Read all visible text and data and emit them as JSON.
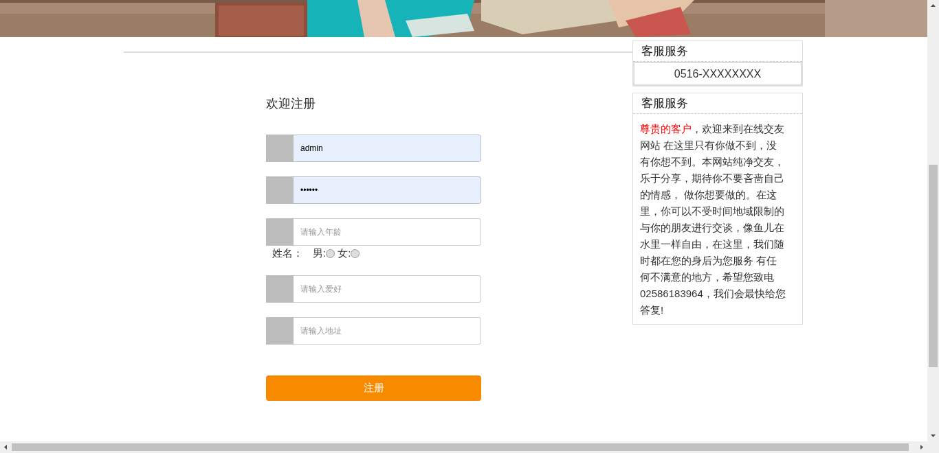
{
  "form": {
    "title": "欢迎注册",
    "fields": [
      {
        "kind": "input",
        "value": "admin",
        "autofilled": true
      },
      {
        "kind": "input",
        "value": "••••••",
        "autofilled": true
      },
      {
        "kind": "input",
        "placeholder": "请输入年龄",
        "autofilled": false
      },
      {
        "kind": "gender",
        "label": "姓名：",
        "options": [
          {
            "label": "男:",
            "selected": false
          },
          {
            "label": "女:",
            "selected": false
          }
        ]
      },
      {
        "kind": "input",
        "placeholder": "请输入爱好",
        "autofilled": false
      },
      {
        "kind": "input",
        "placeholder": "请输入地址",
        "autofilled": false
      }
    ],
    "submit": "注册"
  },
  "sidebar": [
    {
      "kind": "phone",
      "title": "客服服务",
      "phone": "0516-XXXXXXXX"
    },
    {
      "kind": "notice",
      "title": "客服服务",
      "highlight": "尊贵的客户",
      "text": "，欢迎来到在线交友网站 在这里只有你做不到，没有你想不到。本网站纯净交友，乐于分享，期待你不要吝啬自己的情感， 做你想要做的。在这里，你可以不受时间地域限制的与你的朋友进行交谈，像鱼儿在水里一样自由，在这里，我们随时都在您的身后为您服务 有任何不满意的地方，希望您致电02586183964，我们会最快给您答复!"
    }
  ]
}
